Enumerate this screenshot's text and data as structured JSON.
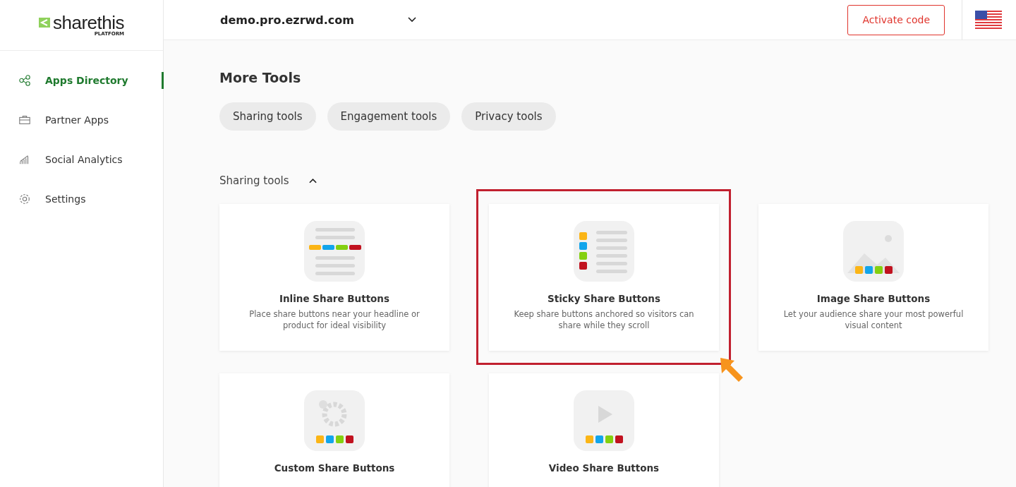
{
  "logo": {
    "name": "sharethis",
    "sub": "PLATFORM"
  },
  "header": {
    "site": "demo.pro.ezrwd.com",
    "activate_button": "Activate code"
  },
  "sidebar": {
    "items": [
      {
        "label": "Apps Directory",
        "kind": "share",
        "selected": true
      },
      {
        "label": "Partner Apps",
        "kind": "briefcase",
        "selected": false
      },
      {
        "label": "Social Analytics",
        "kind": "chart",
        "selected": false
      },
      {
        "label": "Settings",
        "kind": "gear",
        "selected": false
      }
    ]
  },
  "more_tools": {
    "title": "More Tools",
    "chips": [
      "Sharing tools",
      "Engagement tools",
      "Privacy tools"
    ]
  },
  "section": {
    "title": "Sharing tools",
    "expanded": true,
    "cards": [
      {
        "kind": "inline",
        "title": "Inline Share Buttons",
        "description": "Place share buttons near your headline or product for ideal visibility",
        "highlighted": false
      },
      {
        "kind": "sticky",
        "title": "Sticky Share Buttons",
        "description": "Keep share buttons anchored so visitors can share while they scroll",
        "highlighted": true
      },
      {
        "kind": "image",
        "title": "Image Share Buttons",
        "description": "Let your audience share your most powerful visual content",
        "highlighted": false
      },
      {
        "kind": "custom",
        "title": "Custom Share Buttons",
        "highlighted": false
      },
      {
        "kind": "video",
        "title": "Video Share Buttons",
        "highlighted": false
      }
    ]
  }
}
